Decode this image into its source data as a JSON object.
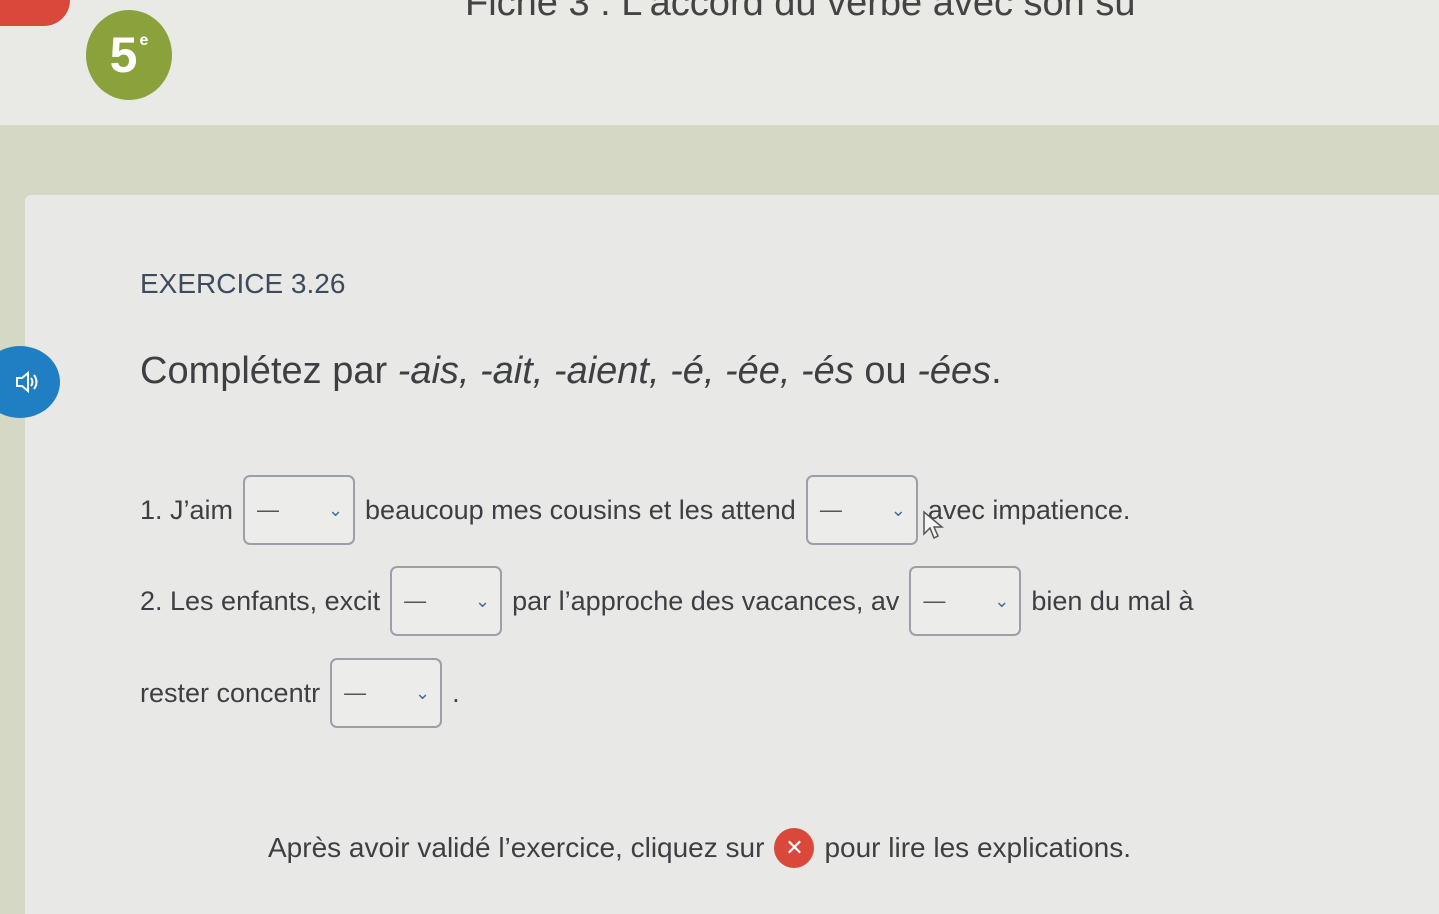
{
  "header": {
    "level": "5",
    "level_sup": "e",
    "title": "Fiche 3 : L'accord du verbe avec son su"
  },
  "exercise": {
    "id": "EXERCICE 3.26",
    "instruction_prefix": "Complétez par ",
    "instruction_options": "-ais, -ait, -aient, -é, -ée, -és",
    "instruction_or": " ou ",
    "instruction_last": "-ées",
    "instruction_end": "."
  },
  "sentences": [
    {
      "parts": [
        "1. J’aim",
        "beaucoup mes cousins et les attend",
        "avec impatience."
      ]
    },
    {
      "parts": [
        "2. Les enfants, excit",
        "par l’approche des vacances, av",
        "bien du mal à"
      ]
    },
    {
      "parts": [
        "rester concentr",
        "."
      ]
    }
  ],
  "select_placeholder": "—",
  "footer": {
    "before": "Après avoir validé l’exercice, cliquez sur",
    "after": "pour lire les explications."
  },
  "colors": {
    "accent_blue": "#1f7fc2",
    "badge_green": "#8aa13c",
    "close_red": "#d9483a"
  }
}
